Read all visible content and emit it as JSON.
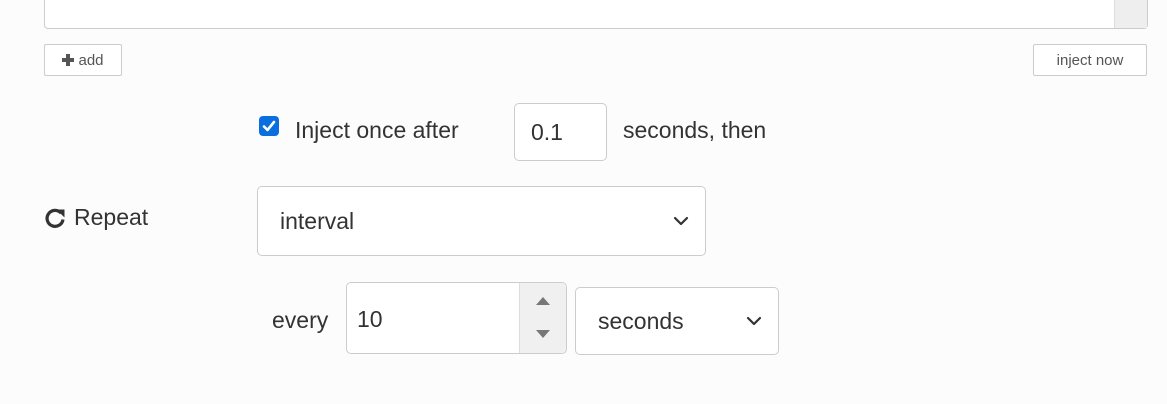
{
  "toolbar": {
    "add_label": "add",
    "inject_now_label": "inject now"
  },
  "inject_once": {
    "checked": true,
    "label": "Inject once after",
    "delay_value": "0.1",
    "suffix": "seconds, then"
  },
  "repeat": {
    "label": "Repeat",
    "mode_selected": "interval"
  },
  "interval": {
    "every_label": "every",
    "value": "10",
    "units_selected": "seconds"
  },
  "colors": {
    "checkbox": "#0a6fde",
    "text": "#333333",
    "border": "#cccccc"
  },
  "icons": {
    "add": "plus-icon",
    "repeat": "redo-icon",
    "dropdown": "chevron-down-icon",
    "check": "check-icon"
  }
}
